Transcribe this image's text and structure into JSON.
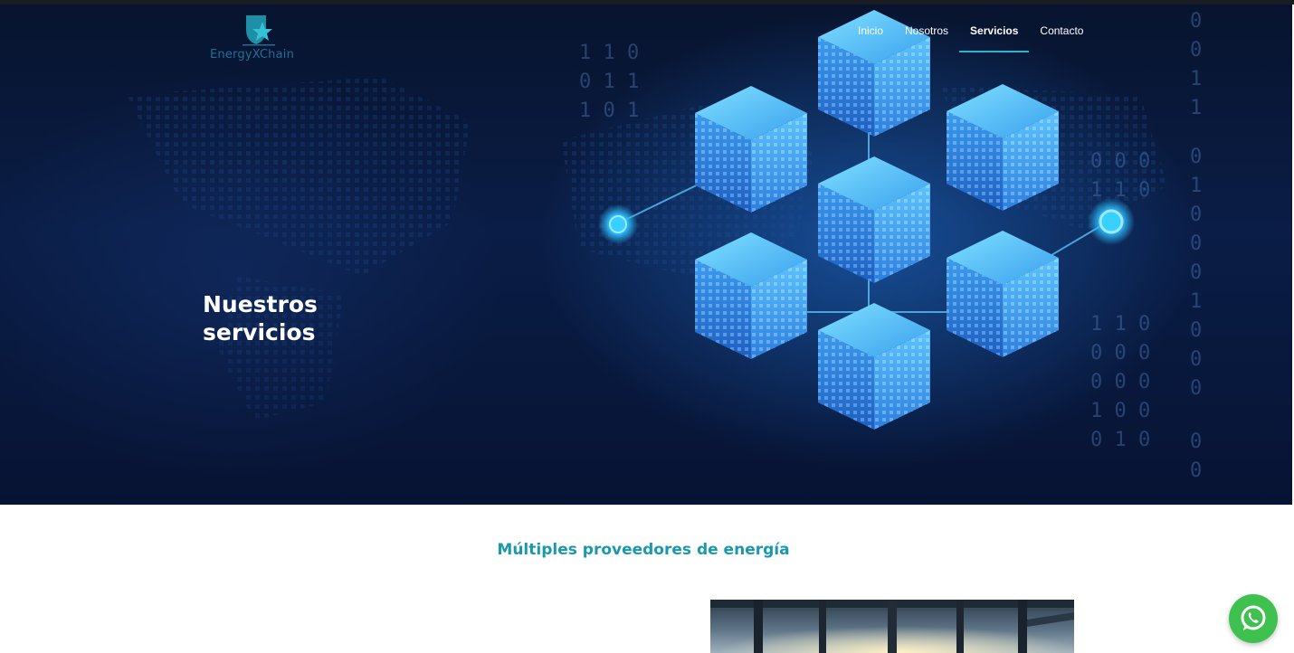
{
  "brand": {
    "name": "EnergyXChain",
    "color": "#1f6f95"
  },
  "nav": {
    "items": [
      {
        "label": "Inicio"
      },
      {
        "label": "Nosotros"
      },
      {
        "label": "Servicios",
        "active": true
      },
      {
        "label": "Contacto"
      }
    ]
  },
  "hero": {
    "title_line1": "Nuestros",
    "title_line2": "servicios",
    "image": "blockchain-cubes-network"
  },
  "section": {
    "heading": "Múltiples proveedores de energía",
    "heading_color": "#1a98ad",
    "image": "city-window-view"
  },
  "whatsapp": {
    "icon": "whatsapp-icon",
    "color": "#3fc150"
  },
  "colors": {
    "hero_bg": "#0a1d46",
    "accent": "#2bb3c9"
  }
}
